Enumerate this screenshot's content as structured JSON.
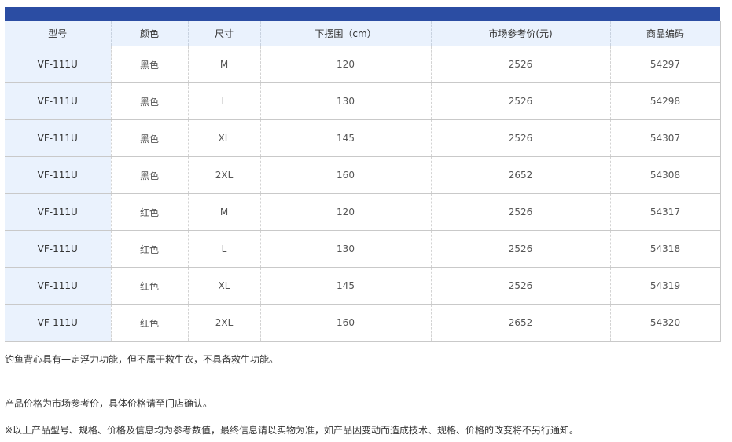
{
  "table": {
    "headers": [
      "型号",
      "颜色",
      "尺寸",
      "下摆围（cm）",
      "市场参考价(元)",
      "商品编码"
    ],
    "rows": [
      [
        "VF-111U",
        "黑色",
        "M",
        "120",
        "2526",
        "54297"
      ],
      [
        "VF-111U",
        "黑色",
        "L",
        "130",
        "2526",
        "54298"
      ],
      [
        "VF-111U",
        "黑色",
        "XL",
        "145",
        "2526",
        "54307"
      ],
      [
        "VF-111U",
        "黑色",
        "2XL",
        "160",
        "2652",
        "54308"
      ],
      [
        "VF-111U",
        "红色",
        "M",
        "120",
        "2526",
        "54317"
      ],
      [
        "VF-111U",
        "红色",
        "L",
        "130",
        "2526",
        "54318"
      ],
      [
        "VF-111U",
        "红色",
        "XL",
        "145",
        "2526",
        "54319"
      ],
      [
        "VF-111U",
        "红色",
        "2XL",
        "160",
        "2652",
        "54320"
      ]
    ]
  },
  "notes": {
    "note1": "钓鱼背心具有一定浮力功能，但不属于救生衣，不具备救生功能。",
    "note2": "产品价格为市场参考价，具体价格请至门店确认。",
    "note3": "※以上产品型号、规格、价格及信息均为参考数值，最终信息请以实物为准，如产品因变动而造成技术、规格、价格的改变将不另行通知。"
  },
  "colors": {
    "top_bar": "#2b4da3",
    "header_bg": "#eaf2fd",
    "model_col_bg": "#eaf2fd"
  }
}
